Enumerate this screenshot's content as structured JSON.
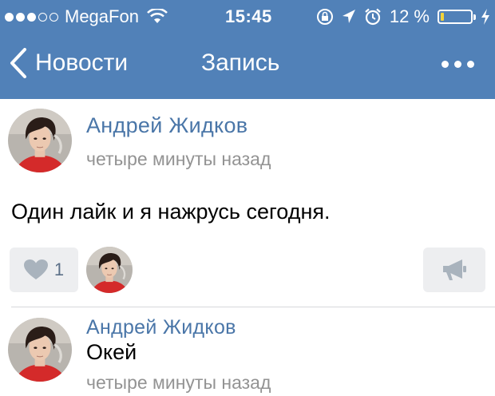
{
  "status_bar": {
    "carrier": "MegaFon",
    "time": "15:45",
    "battery_percent": "12 %",
    "battery_level": 0.12,
    "signal_bars_filled": 3,
    "signal_bars_total": 5,
    "icons": [
      "wifi-icon",
      "rotation-lock-icon",
      "location-icon",
      "alarm-icon",
      "charging-icon"
    ]
  },
  "nav": {
    "back_label": "Новости",
    "title": "Запись",
    "more_icon": "more-dots-icon"
  },
  "post": {
    "author": "Андрей Жидков",
    "time": "четыре минуты назад",
    "text": "Один лайк и я нажрусь сегодня.",
    "likes": "1"
  },
  "comment": {
    "author": "Андрей Жидков",
    "text": "Окей",
    "time": "четыре минуты назад"
  },
  "colors": {
    "header": "#5181b8",
    "link": "#4a76a8",
    "meta": "#939393",
    "button_bg": "#edeef0",
    "icon_gray": "#a9b3bd"
  }
}
